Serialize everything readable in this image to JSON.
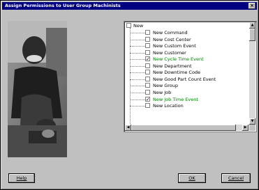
{
  "window": {
    "title": "Assign Permissions to User Group Machinists"
  },
  "tree": {
    "root": {
      "label": "New",
      "checked": false
    },
    "items": [
      {
        "label": "New Command",
        "checked": false,
        "green": false
      },
      {
        "label": "New Cost Center",
        "checked": false,
        "green": false
      },
      {
        "label": "New Custom Event",
        "checked": false,
        "green": false
      },
      {
        "label": "New Customer",
        "checked": false,
        "green": false
      },
      {
        "label": "New Cycle Time Event",
        "checked": true,
        "green": true
      },
      {
        "label": "New Department",
        "checked": false,
        "green": false
      },
      {
        "label": "New Downtime Code",
        "checked": false,
        "green": false
      },
      {
        "label": "New Good Part Count Event",
        "checked": false,
        "green": false
      },
      {
        "label": "New Group",
        "checked": false,
        "green": false
      },
      {
        "label": "New Job",
        "checked": false,
        "green": false
      },
      {
        "label": "New Job Time Event",
        "checked": true,
        "green": true
      },
      {
        "label": "New Location",
        "checked": false,
        "green": false
      }
    ]
  },
  "buttons": {
    "help": "Help",
    "ok": "OK",
    "cancel": "Cancel"
  },
  "icons": {
    "close": "close-icon",
    "scroll_up": "arrow-up-icon",
    "scroll_down": "arrow-down-icon",
    "scroll_left": "arrow-left-icon",
    "scroll_right": "arrow-right-icon"
  }
}
